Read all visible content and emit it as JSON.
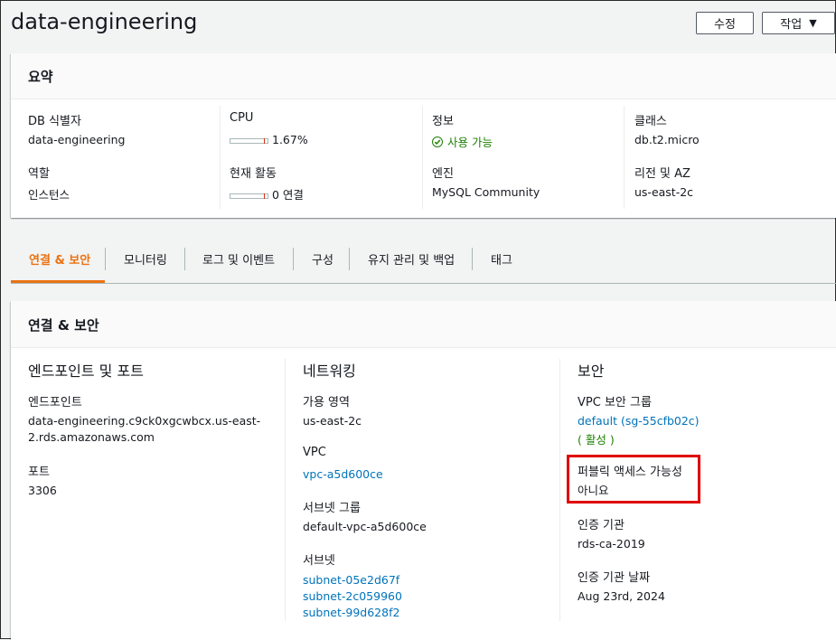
{
  "header": {
    "title": "data-engineering",
    "edit_label": "수정",
    "actions_label": "작업"
  },
  "summary": {
    "heading": "요약",
    "db_id_label": "DB 식별자",
    "db_id_value": "data-engineering",
    "role_label": "역할",
    "role_value": "인스턴스",
    "cpu_label": "CPU",
    "cpu_value": "1.67%",
    "cpu_fraction": 0.0167,
    "activity_label": "현재 활동",
    "activity_value": "0 연결",
    "status_label": "정보",
    "status_value": "사용 가능",
    "engine_label": "엔진",
    "engine_value": "MySQL Community",
    "class_label": "클래스",
    "class_value": "db.t2.micro",
    "region_label": "리전 및 AZ",
    "region_value": "us-east-2c"
  },
  "tabs": [
    {
      "label": "연결 & 보안",
      "active": true
    },
    {
      "label": "모니터링"
    },
    {
      "label": "로그 및 이벤트"
    },
    {
      "label": "구성"
    },
    {
      "label": "유지 관리 및 백업"
    },
    {
      "label": "태그"
    }
  ],
  "connectivity": {
    "heading": "연결 & 보안",
    "endpoint_section": {
      "title": "엔드포인트 및 포트",
      "endpoint_label": "엔드포인트",
      "endpoint_line1": "data-engineering.c9ck0xgcwbcx.us-east-",
      "endpoint_line2": "2.rds.amazonaws.com",
      "port_label": "포트",
      "port_value": "3306"
    },
    "networking_section": {
      "title": "네트워킹",
      "az_label": "가용 영역",
      "az_value": "us-east-2c",
      "vpc_label": "VPC",
      "vpc_value": "vpc-a5d600ce",
      "subnet_group_label": "서브넷 그룹",
      "subnet_group_value": "default-vpc-a5d600ce",
      "subnets_label": "서브넷",
      "subnets": [
        "subnet-05e2d67f",
        "subnet-2c059960",
        "subnet-99d628f2"
      ]
    },
    "security_section": {
      "title": "보안",
      "sg_label": "VPC 보안 그룹",
      "sg_value": "default (sg-55cfb02c)",
      "sg_status": "( 활성 )",
      "public_label": "퍼블릭 액세스 가능성",
      "public_value": "아니요",
      "ca_label": "인증 기관",
      "ca_value": "rds-ca-2019",
      "ca_date_label": "인증 기관 날짜",
      "ca_date_value": "Aug 23rd, 2024"
    }
  },
  "colors": {
    "accent": "#ec7211",
    "link": "#0073bb",
    "success": "#1d8102",
    "highlight": "#e00000"
  }
}
